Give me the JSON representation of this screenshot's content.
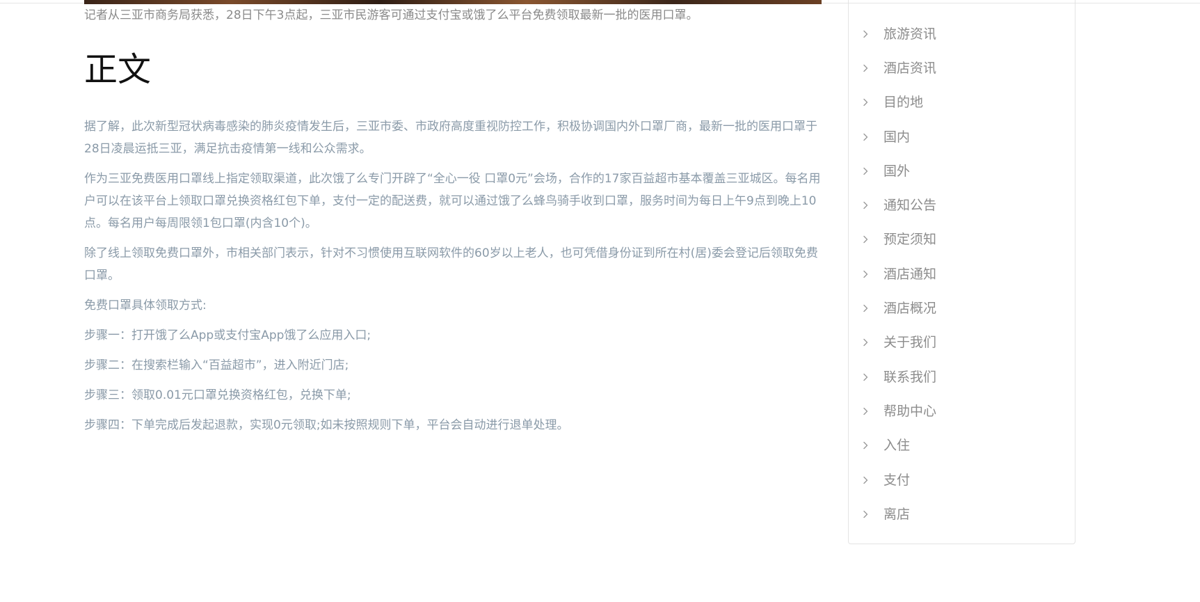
{
  "article": {
    "lead": "记者从三亚市商务局获悉，28日下午3点起，三亚市民游客可通过支付宝或饿了么平台免费领取最新一批的医用口罩。",
    "heading": "正文",
    "paragraphs": [
      "据了解，此次新型冠状病毒感染的肺炎疫情发生后，三亚市委、市政府高度重视防控工作，积极协调国内外口罩厂商，最新一批的医用口罩于28日凌晨运抵三亚，满足抗击疫情第一线和公众需求。",
      "作为三亚免费医用口罩线上指定领取渠道，此次饿了么专门开辟了“全心一役 口罩0元”会场，合作的17家百益超市基本覆盖三亚城区。每名用户可以在该平台上领取口罩兑换资格红包下单，支付一定的配送费，就可以通过饿了么蜂鸟骑手收到口罩，服务时间为每日上午9点到晚上10点。每名用户每周限领1包口罩(内含10个)。",
      "除了线上领取免费口罩外，市相关部门表示，针对不习惯使用互联网软件的60岁以上老人，也可凭借身份证到所在村(居)委会登记后领取免费口罩。",
      "免费口罩具体领取方式:",
      "步骤一：打开饿了么App或支付宝App饿了么应用入口;",
      "步骤二：在搜索栏输入“百益超市”，进入附近门店;",
      "步骤三：领取0.01元口罩兑换资格红包，兑换下单;",
      "步骤四：下单完成后发起退款，实现0元领取;如未按照规则下单，平台会自动进行退单处理。"
    ]
  },
  "sidebar": {
    "chevron_icon": "chevron-right-icon",
    "items": [
      {
        "label": "旅游资讯"
      },
      {
        "label": "酒店资讯"
      },
      {
        "label": "目的地"
      },
      {
        "label": "国内"
      },
      {
        "label": "国外"
      },
      {
        "label": "通知公告"
      },
      {
        "label": "预定须知"
      },
      {
        "label": "酒店通知"
      },
      {
        "label": "酒店概况"
      },
      {
        "label": "关于我们"
      },
      {
        "label": "联系我们"
      },
      {
        "label": "帮助中心"
      },
      {
        "label": "入住"
      },
      {
        "label": "支付"
      },
      {
        "label": "离店"
      }
    ]
  },
  "colors": {
    "heading": "#111111",
    "body_text": "#8a9aa8",
    "lead_text": "#8a8a8a",
    "sidebar_text": "#8c8c8c",
    "chevron": "#999999",
    "border": "#e3e3e3"
  }
}
